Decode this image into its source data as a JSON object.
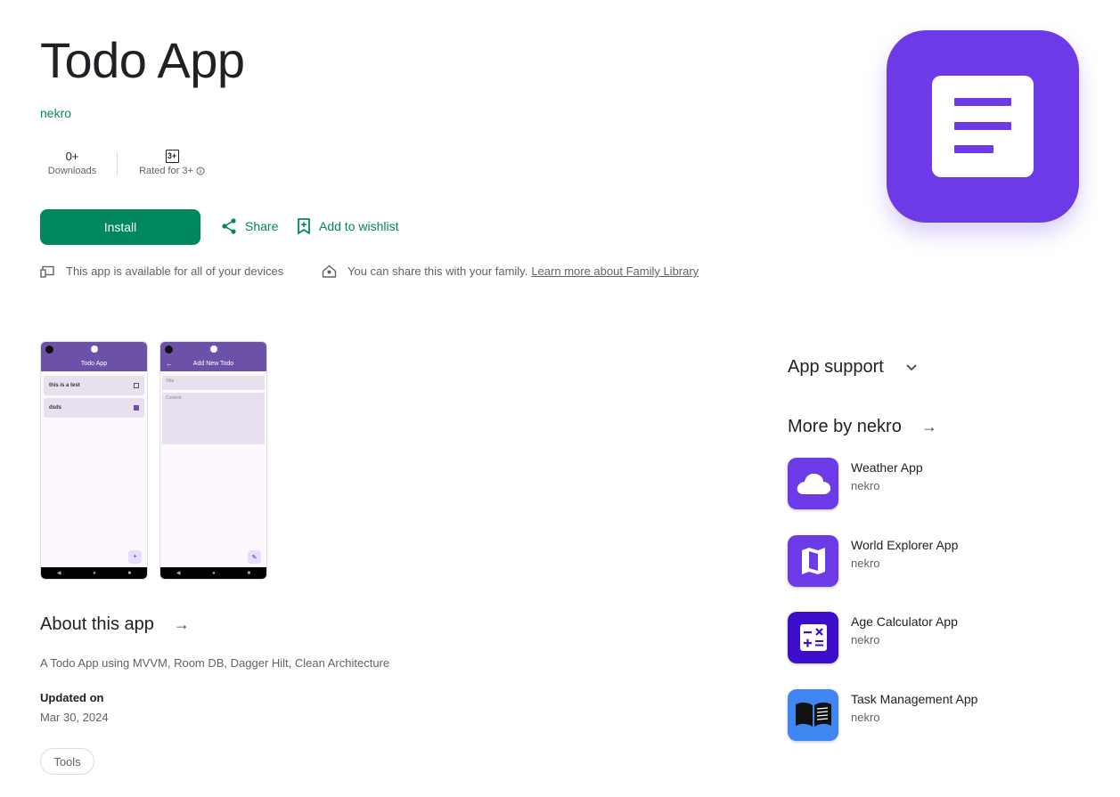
{
  "app": {
    "title": "Todo App",
    "developer": "nekro",
    "downloads_value": "0+",
    "downloads_label": "Downloads",
    "rating_badge": "3+",
    "rating_label": "Rated for 3+",
    "install_label": "Install",
    "share_label": "Share",
    "wishlist_label": "Add to wishlist",
    "devices_note": "This app is available for all of your devices",
    "family_note": "You can share this with your family.",
    "family_link": "Learn more about Family Library",
    "icon": "notes-icon",
    "icon_color": "#6d3ae8"
  },
  "screenshots": [
    {
      "bar_title": "Todo App",
      "items": [
        {
          "text": "this is a test",
          "checked": false
        },
        {
          "text": "dsds",
          "checked": true
        }
      ],
      "fab": "+"
    },
    {
      "bar_title": "Add New Todo",
      "field_title": "Title",
      "field_content": "Content",
      "fab": "✎"
    }
  ],
  "about": {
    "heading": "About this app",
    "description": "A Todo App using MVVM, Room DB, Dagger Hilt, Clean Architecture",
    "updated_label": "Updated on",
    "updated_value": "Mar 30, 2024",
    "category": "Tools"
  },
  "sidebar": {
    "support_heading": "App support",
    "more_heading": "More by nekro",
    "apps": [
      {
        "name": "Weather App",
        "developer": "nekro",
        "icon": "cloud-icon",
        "color": "#6d3ae8"
      },
      {
        "name": "World Explorer App",
        "developer": "nekro",
        "icon": "map-icon",
        "color": "#6d3ae8"
      },
      {
        "name": "Age Calculator App",
        "developer": "nekro",
        "icon": "calculator-icon",
        "color": "#3d0ecc"
      },
      {
        "name": "Task Management App",
        "developer": "nekro",
        "icon": "book-icon",
        "color": "#3f86f2"
      }
    ]
  },
  "colors": {
    "accent": "#01875f",
    "screenshot_bar": "#6b52a8"
  }
}
